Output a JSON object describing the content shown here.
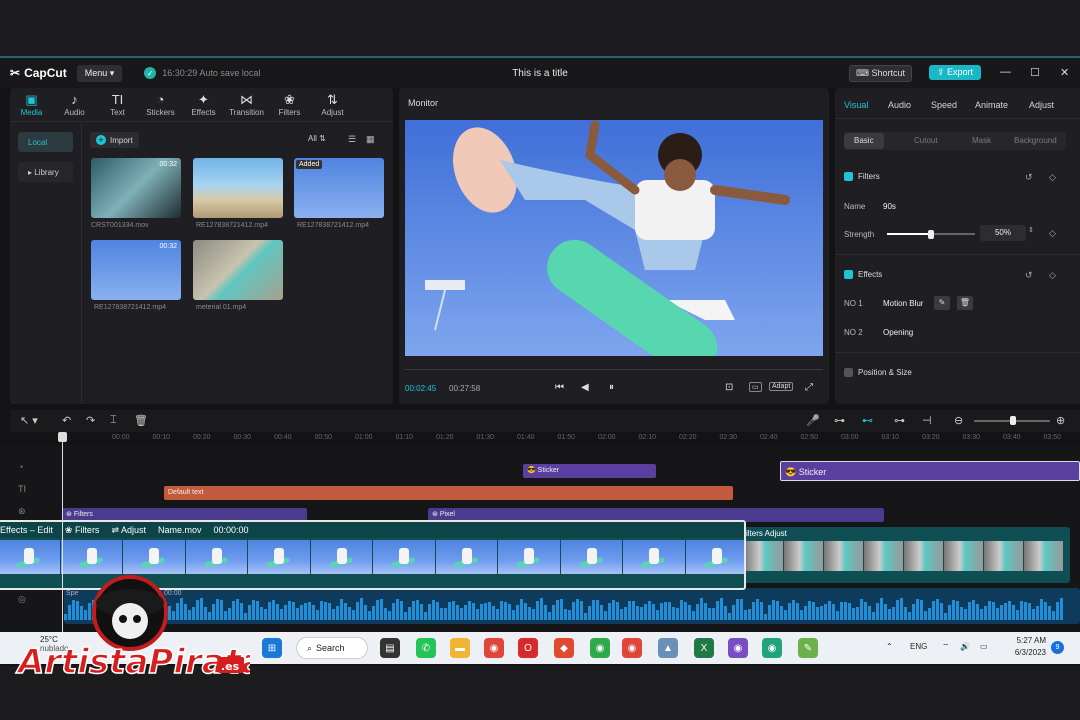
{
  "titlebar": {
    "app_name": "CapCut",
    "menu_label": "Menu",
    "autosave_text": "16:30:29 Auto save local",
    "project_title": "This is a title",
    "shortcut_label": "Shortcut",
    "export_label": "Export"
  },
  "media_panel": {
    "tabs": [
      {
        "label": "Media",
        "icon": "media-icon"
      },
      {
        "label": "Audio",
        "icon": "audio-icon"
      },
      {
        "label": "Text",
        "icon": "text-icon"
      },
      {
        "label": "Stickers",
        "icon": "stickers-icon"
      },
      {
        "label": "Effects",
        "icon": "effects-icon"
      },
      {
        "label": "Transition",
        "icon": "transition-icon"
      },
      {
        "label": "Filters",
        "icon": "filters-icon"
      },
      {
        "label": "Adjust",
        "icon": "adjust-icon"
      }
    ],
    "side": {
      "local": "Local",
      "library": "▸ Library"
    },
    "import_label": "Import",
    "filter_label": "All",
    "items": [
      {
        "name": "CRST001334.mov",
        "duration": "00:32",
        "added": ""
      },
      {
        "name": "RE127838721412.mp4",
        "duration": "",
        "added": ""
      },
      {
        "name": "RE127838721412.mp4",
        "duration": "",
        "added": "Added"
      },
      {
        "name": "RE127838721412.mp4",
        "duration": "00:32",
        "added": ""
      },
      {
        "name": "meterial 01.mp4",
        "duration": "",
        "added": ""
      }
    ]
  },
  "monitor": {
    "title": "Monitor",
    "current_time": "00:02:45",
    "total_time": "00:27:58",
    "adapt_label": "Adapt"
  },
  "properties": {
    "tabs": [
      "Visual",
      "Audio",
      "Speed",
      "Animate",
      "Adjust"
    ],
    "subtabs": [
      "Basic",
      "Cutout",
      "Mask",
      "Background"
    ],
    "filters": {
      "heading": "Filters",
      "name_label": "Name",
      "name_value": "90s",
      "strength_label": "Strength",
      "strength_value": "50%",
      "strength_fraction": 0.5
    },
    "effects": {
      "heading": "Effects",
      "no1_label": "NO 1",
      "no1_value": "Motion Blur",
      "no2_label": "NO 2",
      "no2_value": "Opening"
    },
    "position_heading": "Position & Size"
  },
  "timeline": {
    "ruler": [
      "00:00",
      "00:10",
      "00:20",
      "00:30",
      "00:40",
      "00:50",
      "01:00",
      "01:10",
      "01:20",
      "01:30",
      "01:40",
      "01:50",
      "02:00",
      "02:10",
      "02:20",
      "02:30",
      "02:40",
      "02:50",
      "03:00",
      "03:10",
      "03:20",
      "03:30",
      "03:40",
      "03:50"
    ],
    "sticker_1": "Sticker",
    "sticker_2": "Sticker",
    "text_clip": "Default text",
    "filters_clip": "Filters",
    "pixel_clip": "Pixel",
    "main_clip": {
      "effects": "Effects – Edit",
      "filters": "Filters",
      "adjust": "Adjust",
      "name": "Name.mov",
      "time": "00:00:00"
    },
    "clip2_head": "ilters  Adjust",
    "audio_label": "Spe",
    "audio_time": "00:00"
  },
  "taskbar": {
    "weather_temp": "25°C",
    "weather_desc": "nublado",
    "search_label": "Search",
    "lang": "ENG",
    "time": "5:27 AM",
    "date": "6/3/2023",
    "notifications": "9"
  },
  "watermark": {
    "text": "ArtistaPirata",
    "suffix": ".es"
  }
}
